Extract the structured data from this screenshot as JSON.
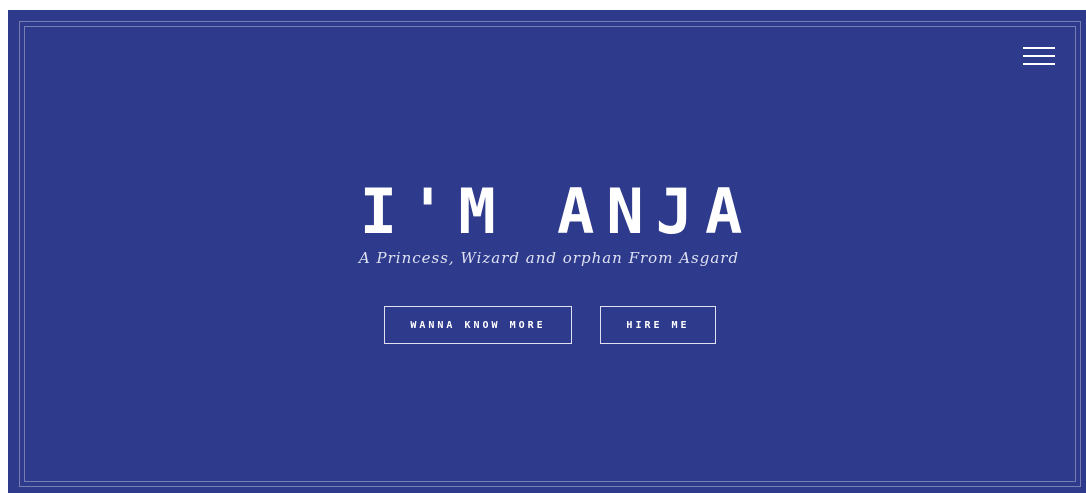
{
  "hero": {
    "title": "I'M ANJA",
    "subtitle": "A Princess, Wizard and orphan From Asgard",
    "background_color": "#2e3a8c"
  },
  "nav": {
    "menu_icon": "hamburger-menu-icon"
  },
  "buttons": {
    "more_label": "WANNA KNOW MORE",
    "hire_label": "HIRE ME"
  }
}
